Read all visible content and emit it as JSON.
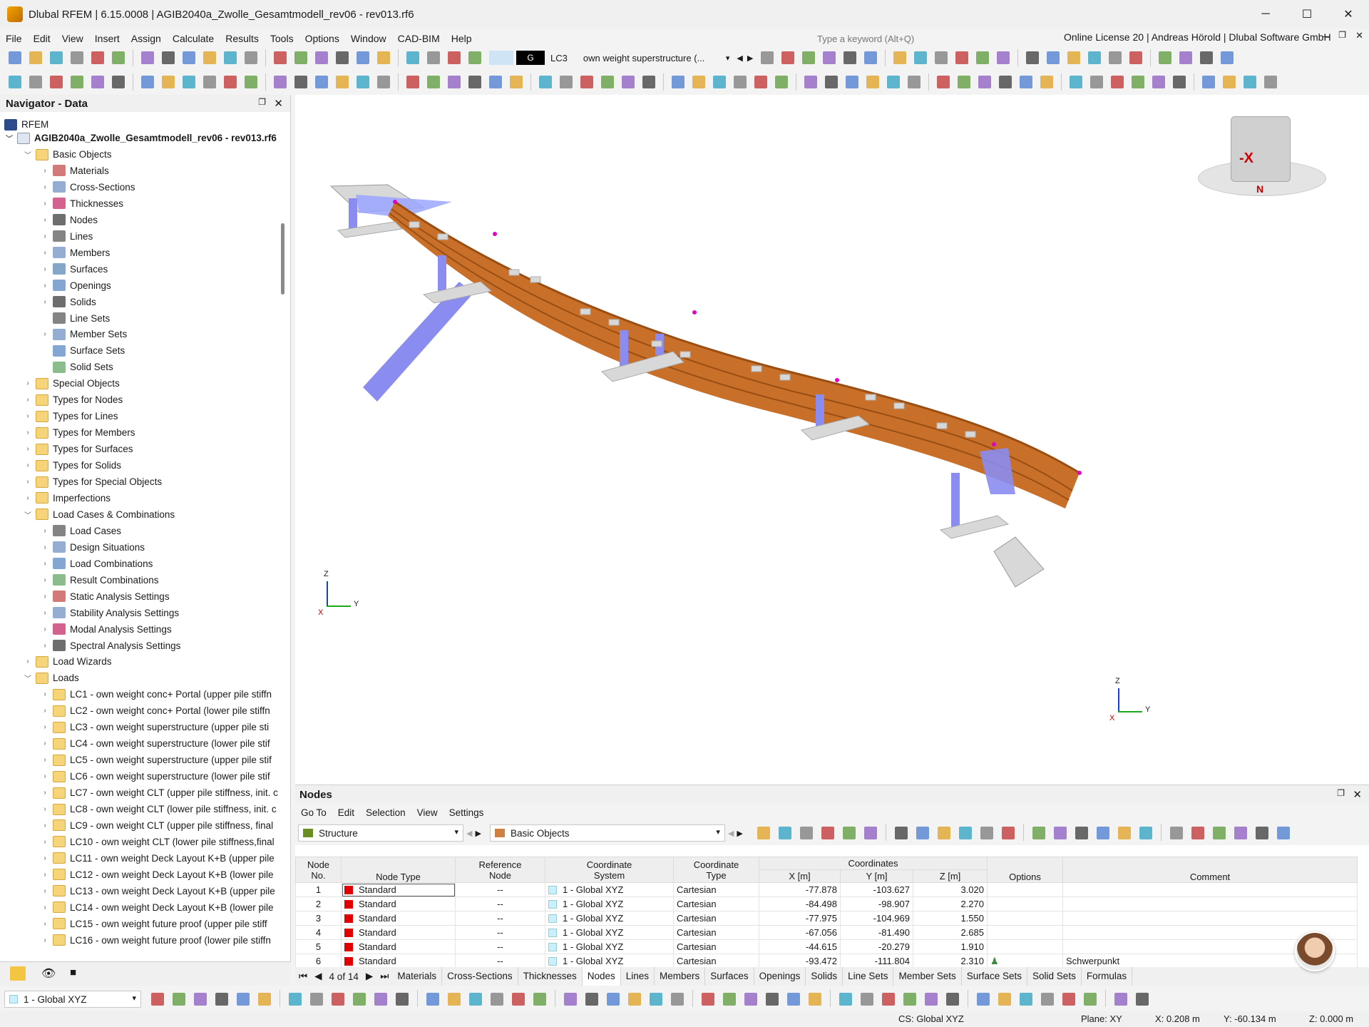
{
  "window": {
    "title": "Dlubal RFEM | 6.15.0008 | AGIB2040a_Zwolle_Gesamtmodell_rev06 - rev013.rf6",
    "minimize": "─",
    "maximize": "☐",
    "close": "✕"
  },
  "menu": [
    "File",
    "Edit",
    "View",
    "Insert",
    "Assign",
    "Calculate",
    "Results",
    "Tools",
    "Options",
    "Window",
    "CAD-BIM",
    "Help"
  ],
  "search": {
    "placeholder": "Type a keyword (Alt+Q)"
  },
  "license": "Online License 20 | Andreas Hörold | Dlubal Software GmbH",
  "loadcase": {
    "group": "G",
    "id": "LC3",
    "desc": "own weight superstructure (..."
  },
  "navigator": {
    "title": "Navigator - Data",
    "root": "RFEM",
    "file": "AGIB2040a_Zwolle_Gesamtmodell_rev06 - rev013.rf6",
    "items": [
      {
        "label": "Basic Objects",
        "level": 1,
        "expanded": true
      },
      {
        "label": "Materials",
        "level": 2
      },
      {
        "label": "Cross-Sections",
        "level": 2
      },
      {
        "label": "Thicknesses",
        "level": 2
      },
      {
        "label": "Nodes",
        "level": 2
      },
      {
        "label": "Lines",
        "level": 2
      },
      {
        "label": "Members",
        "level": 2
      },
      {
        "label": "Surfaces",
        "level": 2
      },
      {
        "label": "Openings",
        "level": 2
      },
      {
        "label": "Solids",
        "level": 2
      },
      {
        "label": "Line Sets",
        "level": 2
      },
      {
        "label": "Member Sets",
        "level": 2
      },
      {
        "label": "Surface Sets",
        "level": 2
      },
      {
        "label": "Solid Sets",
        "level": 2
      },
      {
        "label": "Special Objects",
        "level": 1
      },
      {
        "label": "Types for Nodes",
        "level": 1
      },
      {
        "label": "Types for Lines",
        "level": 1
      },
      {
        "label": "Types for Members",
        "level": 1
      },
      {
        "label": "Types for Surfaces",
        "level": 1
      },
      {
        "label": "Types for Solids",
        "level": 1
      },
      {
        "label": "Types for Special Objects",
        "level": 1
      },
      {
        "label": "Imperfections",
        "level": 1
      },
      {
        "label": "Load Cases & Combinations",
        "level": 1,
        "expanded": true
      },
      {
        "label": "Load Cases",
        "level": 2
      },
      {
        "label": "Design Situations",
        "level": 2
      },
      {
        "label": "Load Combinations",
        "level": 2
      },
      {
        "label": "Result Combinations",
        "level": 2
      },
      {
        "label": "Static Analysis Settings",
        "level": 2
      },
      {
        "label": "Stability Analysis Settings",
        "level": 2
      },
      {
        "label": "Modal Analysis Settings",
        "level": 2
      },
      {
        "label": "Spectral Analysis Settings",
        "level": 2
      },
      {
        "label": "Load Wizards",
        "level": 1
      },
      {
        "label": "Loads",
        "level": 1,
        "expanded": true
      },
      {
        "label": "LC1 - own weight conc+ Portal (upper pile stiffn",
        "level": 2
      },
      {
        "label": "LC2 - own weight conc+ Portal (lower pile stiffn",
        "level": 2
      },
      {
        "label": "LC3 - own weight superstructure (upper pile sti",
        "level": 2
      },
      {
        "label": "LC4 - own weight superstructure (lower pile stif",
        "level": 2
      },
      {
        "label": "LC5 - own weight superstructure (upper pile stif",
        "level": 2
      },
      {
        "label": "LC6 - own weight superstructure (lower pile stif",
        "level": 2
      },
      {
        "label": "LC7 - own weight CLT (upper pile stiffness, init. c",
        "level": 2
      },
      {
        "label": "LC8 - own weight CLT (lower pile stiffness, init. c",
        "level": 2
      },
      {
        "label": "LC9 - own weight CLT (upper pile stiffness, final",
        "level": 2
      },
      {
        "label": "LC10 - own weight CLT (lower pile stiffness,final",
        "level": 2
      },
      {
        "label": "LC11 - own weight Deck Layout K+B (upper pile",
        "level": 2
      },
      {
        "label": "LC12 - own weight Deck Layout K+B (lower pile",
        "level": 2
      },
      {
        "label": "LC13 - own weight Deck Layout K+B (upper pile",
        "level": 2
      },
      {
        "label": "LC14 - own weight Deck Layout K+B (lower pile",
        "level": 2
      },
      {
        "label": "LC15 - own weight future proof (upper pile stiff",
        "level": 2
      },
      {
        "label": "LC16 - own weight future proof (lower pile stiffn",
        "level": 2
      }
    ]
  },
  "viewcube": {
    "face": "-X",
    "north": "N"
  },
  "axes": {
    "x": "X",
    "y": "Y",
    "z": "Z"
  },
  "nodes_panel": {
    "title": "Nodes",
    "menu": [
      "Go To",
      "Edit",
      "Selection",
      "View",
      "Settings"
    ],
    "structure_combo": "Structure",
    "objects_combo": "Basic Objects",
    "headers": {
      "no": "Node\nNo.",
      "type": "Node Type",
      "ref": "Reference\nNode",
      "cs": "Coordinate\nSystem",
      "ctype": "Coordinate\nType",
      "coords": "Coordinates",
      "x": "X [m]",
      "y": "Y [m]",
      "z": "Z [m]",
      "options": "Options",
      "comment": "Comment"
    },
    "rows": [
      {
        "no": "1",
        "type": "Standard",
        "ref": "--",
        "cs": "1 - Global XYZ",
        "ctype": "Cartesian",
        "x": "-77.878",
        "y": "-103.627",
        "z": "3.020",
        "comment": ""
      },
      {
        "no": "2",
        "type": "Standard",
        "ref": "--",
        "cs": "1 - Global XYZ",
        "ctype": "Cartesian",
        "x": "-84.498",
        "y": "-98.907",
        "z": "2.270",
        "comment": ""
      },
      {
        "no": "3",
        "type": "Standard",
        "ref": "--",
        "cs": "1 - Global XYZ",
        "ctype": "Cartesian",
        "x": "-77.975",
        "y": "-104.969",
        "z": "1.550",
        "comment": ""
      },
      {
        "no": "4",
        "type": "Standard",
        "ref": "--",
        "cs": "1 - Global XYZ",
        "ctype": "Cartesian",
        "x": "-67.056",
        "y": "-81.490",
        "z": "2.685",
        "comment": ""
      },
      {
        "no": "5",
        "type": "Standard",
        "ref": "--",
        "cs": "1 - Global XYZ",
        "ctype": "Cartesian",
        "x": "-44.615",
        "y": "-20.279",
        "z": "1.910",
        "comment": ""
      },
      {
        "no": "6",
        "type": "Standard",
        "ref": "--",
        "cs": "1 - Global XYZ",
        "ctype": "Cartesian",
        "x": "-93.472",
        "y": "-111.804",
        "z": "2.310",
        "comment": "Schwerpunkt"
      }
    ],
    "pager": "4 of 14",
    "tabs": [
      "Materials",
      "Cross-Sections",
      "Thicknesses",
      "Nodes",
      "Lines",
      "Members",
      "Surfaces",
      "Openings",
      "Solids",
      "Line Sets",
      "Member Sets",
      "Surface Sets",
      "Solid Sets",
      "Formulas"
    ],
    "active_tab": "Nodes"
  },
  "bottom": {
    "cs_combo": "1 - Global XYZ"
  },
  "status": {
    "cs": "CS: Global XYZ",
    "plane": "Plane: XY",
    "x": "X: 0.208 m",
    "y": "Y: -60.134 m",
    "z": "Z: 0.000 m"
  },
  "colors": {
    "deck": "#c8702a",
    "support": "#8a8cf0",
    "marker": "#e000c8",
    "pad": "#d8d8d8"
  }
}
